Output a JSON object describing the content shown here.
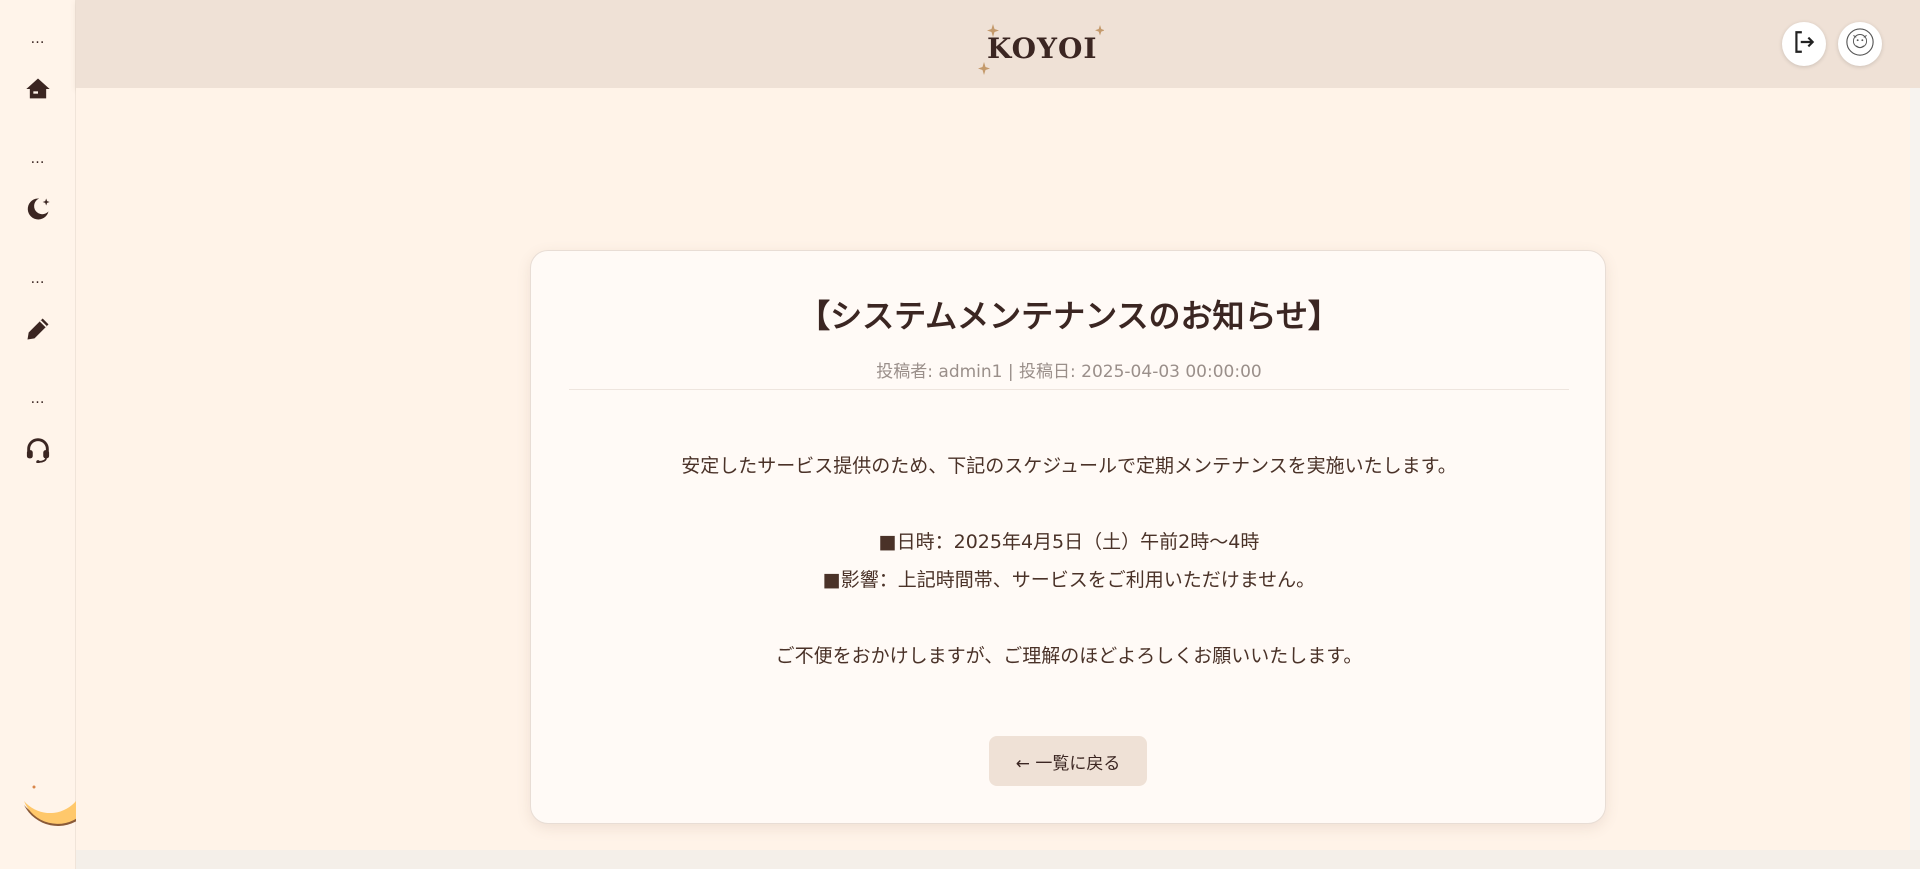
{
  "sidebar": {
    "sections": [
      {
        "dots": "…",
        "icon": "home-icon"
      },
      {
        "dots": "…",
        "icon": "moon-star-icon"
      },
      {
        "dots": "…",
        "icon": "pencil-icon"
      },
      {
        "dots": "…",
        "icon": "headset-icon"
      }
    ],
    "decoration": "crescent-moon-icon"
  },
  "header": {
    "logo_text": "KOYOI",
    "logout_icon": "logout-icon",
    "avatar_icon": "avatar-icon"
  },
  "notice": {
    "title": "【システムメンテナンスのお知らせ】",
    "meta": "投稿者: admin1 | 投稿日: 2025-04-03 00:00:00",
    "lines": [
      "安定したサービス提供のため、下記のスケジュールで定期メンテナンスを実施いたします。",
      "■日時：2025年4月5日（土）午前2時〜4時",
      "■影響：上記時間帯、サービスをご利用いただけません。",
      "ご不便をおかけしますが、ご理解のほどよろしくお願いいたします。"
    ],
    "back_label": "← 一覧に戻る"
  },
  "colors": {
    "sidebar_bg": "#fff4ea",
    "header_bg": "#efe1d6",
    "main_bg": "#fff3e8",
    "card_bg": "#fffaf6",
    "text_dark": "#3b2622",
    "accent_gold": "#c49a6c"
  }
}
